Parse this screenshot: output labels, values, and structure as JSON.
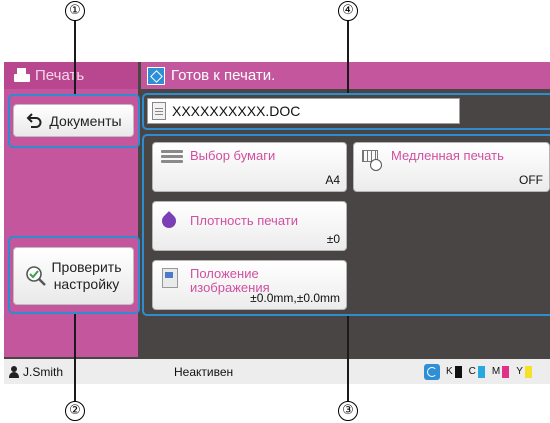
{
  "callouts": [
    "①",
    "②",
    "③",
    "④"
  ],
  "sidebar": {
    "title": "Печать",
    "documents_button": "Документы",
    "check_button_line1": "Проверить",
    "check_button_line2": "настройку"
  },
  "header": {
    "status_text": "Готов к печати."
  },
  "file": {
    "name": "XXXXXXXXXX.DOC"
  },
  "tiles": {
    "paper": {
      "label": "Выбор бумаги",
      "value": "A4"
    },
    "slow": {
      "label": "Медленная печать",
      "value": "OFF"
    },
    "density": {
      "label": "Плотность печати",
      "value": "±0"
    },
    "position": {
      "label_line1": "Положение",
      "label_line2": "изображения",
      "value": "±0.0mm,±0.0mm"
    }
  },
  "status_bar": {
    "user": "J.Smith",
    "state": "Неактивен",
    "inks": [
      {
        "label": "K",
        "color": "#111111"
      },
      {
        "label": "C",
        "color": "#29a8e0"
      },
      {
        "label": "M",
        "color": "#e0308a"
      },
      {
        "label": "Y",
        "color": "#f5e12a"
      }
    ]
  },
  "colors": {
    "accent": "#c4569e",
    "screen_background": "#4a4545",
    "highlight_frame": "#2f8ccf"
  }
}
